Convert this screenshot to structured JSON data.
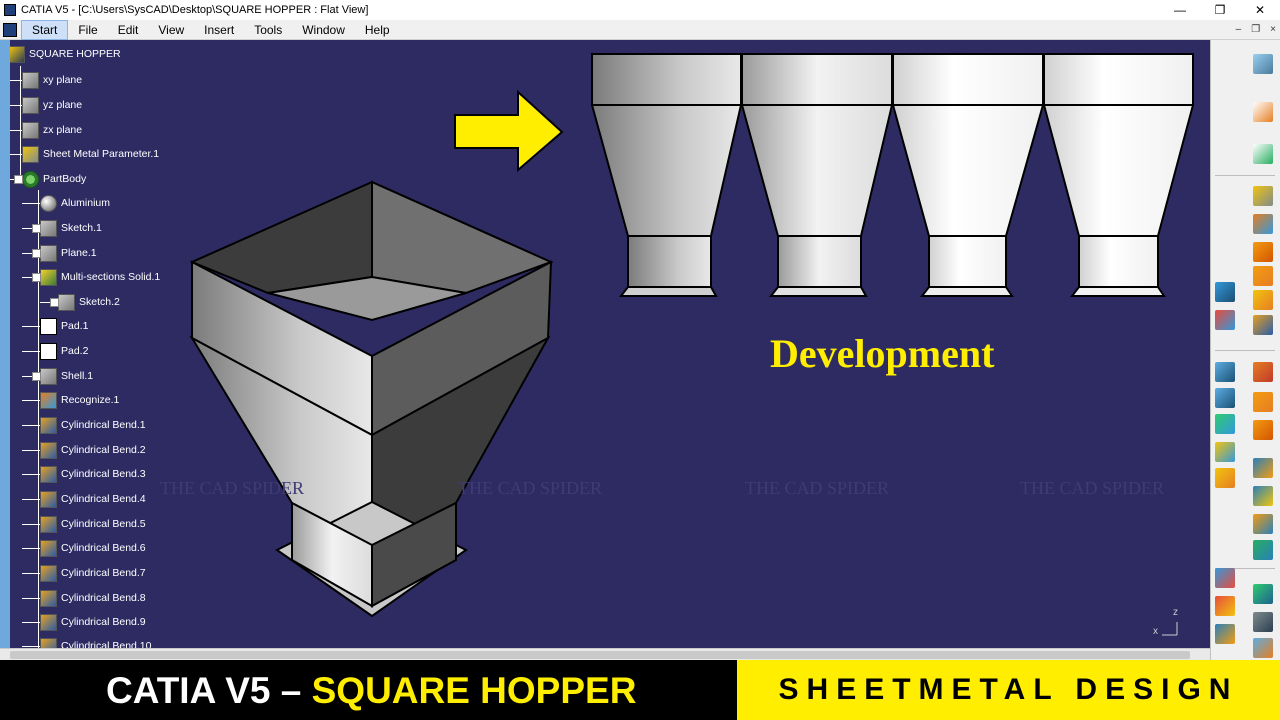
{
  "window": {
    "title": "CATIA V5 - [C:\\Users\\SysCAD\\Desktop\\SQUARE HOPPER : Flat View]",
    "controls": [
      "—",
      "❐",
      "✕"
    ]
  },
  "menubar": {
    "items": [
      "Start",
      "File",
      "Edit",
      "View",
      "Insert",
      "Tools",
      "Window",
      "Help"
    ],
    "mdi_controls": [
      "–",
      "❐",
      "×"
    ]
  },
  "tree": {
    "items": [
      {
        "label": "SQUARE HOPPER",
        "icon": "root-icon"
      },
      {
        "label": "xy plane",
        "icon": "plane-icon"
      },
      {
        "label": "yz plane",
        "icon": "plane-icon"
      },
      {
        "label": "zx plane",
        "icon": "plane-icon"
      },
      {
        "label": "Sheet Metal Parameter.1",
        "icon": "sheet-metal-icon"
      },
      {
        "label": "PartBody",
        "icon": "gear-icon"
      },
      {
        "label": "Aluminium",
        "icon": "material-icon"
      },
      {
        "label": "Sketch.1",
        "icon": "sketch-icon"
      },
      {
        "label": "Plane.1",
        "icon": "plane-icon"
      },
      {
        "label": "Multi-sections Solid.1",
        "icon": "loft-icon"
      },
      {
        "label": "Sketch.2",
        "icon": "sketch-icon"
      },
      {
        "label": "Pad.1",
        "icon": "pad-icon"
      },
      {
        "label": "Pad.2",
        "icon": "pad-icon"
      },
      {
        "label": "Shell.1",
        "icon": "shell-icon"
      },
      {
        "label": "Recognize.1",
        "icon": "recognize-icon"
      },
      {
        "label": "Cylindrical Bend.1",
        "icon": "bend-icon"
      },
      {
        "label": "Cylindrical Bend.2",
        "icon": "bend-icon"
      },
      {
        "label": "Cylindrical Bend.3",
        "icon": "bend-icon"
      },
      {
        "label": "Cylindrical Bend.4",
        "icon": "bend-icon"
      },
      {
        "label": "Cylindrical Bend.5",
        "icon": "bend-icon"
      },
      {
        "label": "Cylindrical Bend.6",
        "icon": "bend-icon"
      },
      {
        "label": "Cylindrical Bend.7",
        "icon": "bend-icon"
      },
      {
        "label": "Cylindrical Bend.8",
        "icon": "bend-icon"
      },
      {
        "label": "Cylindrical Bend.9",
        "icon": "bend-icon"
      },
      {
        "label": "Cylindrical Bend.10",
        "icon": "bend-icon"
      }
    ]
  },
  "viewport": {
    "watermark": "THE CAD SPIDER",
    "development_label": "Development",
    "compass": {
      "x": "x",
      "z": "z"
    }
  },
  "banner": {
    "left_prefix": "CATIA V5 – ",
    "left_accent": "SQUARE HOPPER",
    "right": "SHEETMETAL DESIGN"
  },
  "colors": {
    "viewport_bg": "#2e2b63",
    "accent_yellow": "#ffee00",
    "banner_bg": "#000000"
  }
}
